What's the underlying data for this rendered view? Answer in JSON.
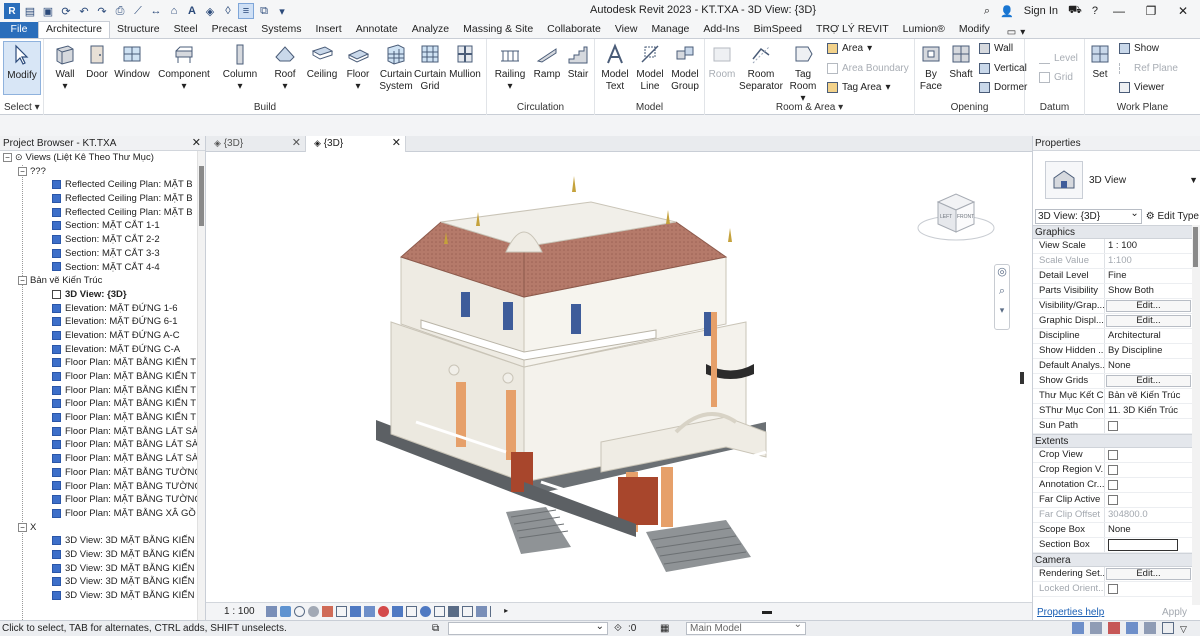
{
  "title_bar": {
    "app_title": "Autodesk Revit 2023 - KT.TXA - 3D View: {3D}",
    "sign_in": "Sign In",
    "help": "?"
  },
  "tabs": [
    {
      "label": "File"
    },
    {
      "label": "Architecture"
    },
    {
      "label": "Structure"
    },
    {
      "label": "Steel"
    },
    {
      "label": "Precast"
    },
    {
      "label": "Systems"
    },
    {
      "label": "Insert"
    },
    {
      "label": "Annotate"
    },
    {
      "label": "Analyze"
    },
    {
      "label": "Massing & Site"
    },
    {
      "label": "Collaborate"
    },
    {
      "label": "View"
    },
    {
      "label": "Manage"
    },
    {
      "label": "Add-Ins"
    },
    {
      "label": "BimSpeed"
    },
    {
      "label": "TRỢ LÝ REVIT"
    },
    {
      "label": "Lumion®"
    },
    {
      "label": "Modify"
    }
  ],
  "ribbon": {
    "select": {
      "modify": "Modify",
      "label": "Select"
    },
    "build": {
      "label": "Build",
      "wall": "Wall",
      "door": "Door",
      "window": "Window",
      "component": "Component",
      "column": "Column",
      "roof": "Roof",
      "ceiling": "Ceiling",
      "floor": "Floor",
      "curtain_system": "Curtain System",
      "curtain_grid": "Curtain Grid",
      "mullion": "Mullion"
    },
    "circulation": {
      "label": "Circulation",
      "railing": "Railing",
      "ramp": "Ramp",
      "stair": "Stair"
    },
    "model": {
      "label": "Model",
      "model_text": "Model Text",
      "model_line": "Model Line",
      "model_group": "Model Group"
    },
    "room_area": {
      "label": "Room & Area",
      "room": "Room",
      "room_separator": "Room Separator",
      "tag_room": "Tag Room",
      "area": "Area",
      "area_boundary": "Area Boundary",
      "tag_area": "Tag Area"
    },
    "opening": {
      "label": "Opening",
      "by_face": "By Face",
      "shaft": "Shaft",
      "wall": "Wall",
      "vertical": "Vertical",
      "dormer": "Dormer"
    },
    "datum": {
      "label": "Datum",
      "level": "Level",
      "grid": "Grid"
    },
    "work_plane": {
      "label": "Work Plane",
      "set": "Set",
      "show": "Show",
      "ref_plane": "Ref Plane",
      "viewer": "Viewer"
    }
  },
  "project_browser": {
    "title": "Project Browser - KT.TXA",
    "root": "Views (Liệt Kê Theo Thư Mục)",
    "groups": [
      {
        "label": "???",
        "items": [
          "Reflected Ceiling Plan: MẶT B",
          "Reflected Ceiling Plan: MẶT B",
          "Reflected Ceiling Plan: MẶT B",
          "Section: MẶT CẮT 1-1",
          "Section: MẶT CẮT 2-2",
          "Section: MẶT CẮT 3-3",
          "Section: MẶT CẮT 4-4"
        ]
      },
      {
        "label": "Bản vẽ Kiến Trúc",
        "items": [
          "3D View: {3D}",
          "Elevation: MẶT ĐỨNG 1-6",
          "Elevation: MẶT ĐỨNG 6-1",
          "Elevation: MẶT ĐỨNG A-C",
          "Elevation: MẶT ĐỨNG C-A",
          "Floor Plan: MẶT BẰNG KIẾN TI",
          "Floor Plan: MẶT BẰNG KIẾN TI",
          "Floor Plan: MẶT BẰNG KIẾN TI",
          "Floor Plan: MẶT BẰNG KIẾN TI",
          "Floor Plan: MẶT BẰNG KIẾN TI",
          "Floor Plan: MẶT BẰNG LÁT SÀ",
          "Floor Plan: MẶT BẰNG LÁT SÀ",
          "Floor Plan: MẶT BẰNG LÁT SÀ",
          "Floor Plan: MẶT BẰNG TƯỜNG",
          "Floor Plan: MẶT BẰNG TƯỜNG",
          "Floor Plan: MẶT BẰNG TƯỜNG",
          "Floor Plan: MẶT BẰNG XÂ GỒ"
        ]
      },
      {
        "label": "X",
        "items": [
          "3D View: 3D MẶT BẰNG KIẾN",
          "3D View: 3D MẶT BẰNG KIẾN",
          "3D View: 3D MẶT BẰNG KIẾN",
          "3D View: 3D MẶT BẰNG KIẾN",
          "3D View: 3D MẶT BẰNG KIẾN"
        ]
      }
    ]
  },
  "view_tabs": [
    {
      "label": "{3D}"
    },
    {
      "label": "{3D}"
    }
  ],
  "viewcube": {
    "left": "LEFT",
    "front": "FRONT"
  },
  "view_control": {
    "scale": "1 : 100"
  },
  "properties": {
    "title": "Properties",
    "type_name": "3D View",
    "instance": "3D View: {3D}",
    "edit_type": "Edit Type",
    "groups": [
      {
        "label": "Graphics",
        "rows": [
          {
            "name": "View Scale",
            "value": "1 : 100",
            "kind": "text"
          },
          {
            "name": "Scale Value",
            "value": "1:100",
            "kind": "text",
            "dim": true
          },
          {
            "name": "Detail Level",
            "value": "Fine",
            "kind": "text"
          },
          {
            "name": "Parts Visibility",
            "value": "Show Both",
            "kind": "text"
          },
          {
            "name": "Visibility/Grap...",
            "value": "Edit...",
            "kind": "button"
          },
          {
            "name": "Graphic Displ...",
            "value": "Edit...",
            "kind": "button"
          },
          {
            "name": "Discipline",
            "value": "Architectural",
            "kind": "text"
          },
          {
            "name": "Show Hidden ...",
            "value": "By Discipline",
            "kind": "text"
          },
          {
            "name": "Default Analys...",
            "value": "None",
            "kind": "text"
          },
          {
            "name": "Show Grids",
            "value": "Edit...",
            "kind": "button"
          },
          {
            "name": "Thư Mục Kết C...",
            "value": "Bản vẽ Kiến Trúc",
            "kind": "text"
          },
          {
            "name": "SThư Mục Con",
            "value": "11. 3D Kiến Trúc",
            "kind": "text"
          },
          {
            "name": "Sun Path",
            "value": "",
            "kind": "check"
          }
        ]
      },
      {
        "label": "Extents",
        "rows": [
          {
            "name": "Crop View",
            "value": "",
            "kind": "check"
          },
          {
            "name": "Crop Region V...",
            "value": "",
            "kind": "check"
          },
          {
            "name": "Annotation Cr...",
            "value": "",
            "kind": "check"
          },
          {
            "name": "Far Clip Active",
            "value": "",
            "kind": "check"
          },
          {
            "name": "Far Clip Offset",
            "value": "304800.0",
            "kind": "text",
            "dim": true
          },
          {
            "name": "Scope Box",
            "value": "None",
            "kind": "text"
          },
          {
            "name": "Section Box",
            "value": "",
            "kind": "wide-check"
          }
        ]
      },
      {
        "label": "Camera",
        "rows": [
          {
            "name": "Rendering Set...",
            "value": "Edit...",
            "kind": "button"
          },
          {
            "name": "Locked Orient...",
            "value": "",
            "kind": "check",
            "dim": true
          }
        ]
      }
    ],
    "help": "Properties help",
    "apply": "Apply"
  },
  "status_bar": {
    "hint": "Click to select, TAB for alternates, CTRL adds, SHIFT unselects.",
    "zero": ":0",
    "model": "Main Model"
  },
  "colors": {
    "accent": "#2a6ebb",
    "roof": "#b87c6c",
    "wall": "#f0ede4",
    "column": "#e6a06a",
    "door": "#a8462c",
    "window": "#3e5c9a",
    "base": "#5f6366"
  }
}
